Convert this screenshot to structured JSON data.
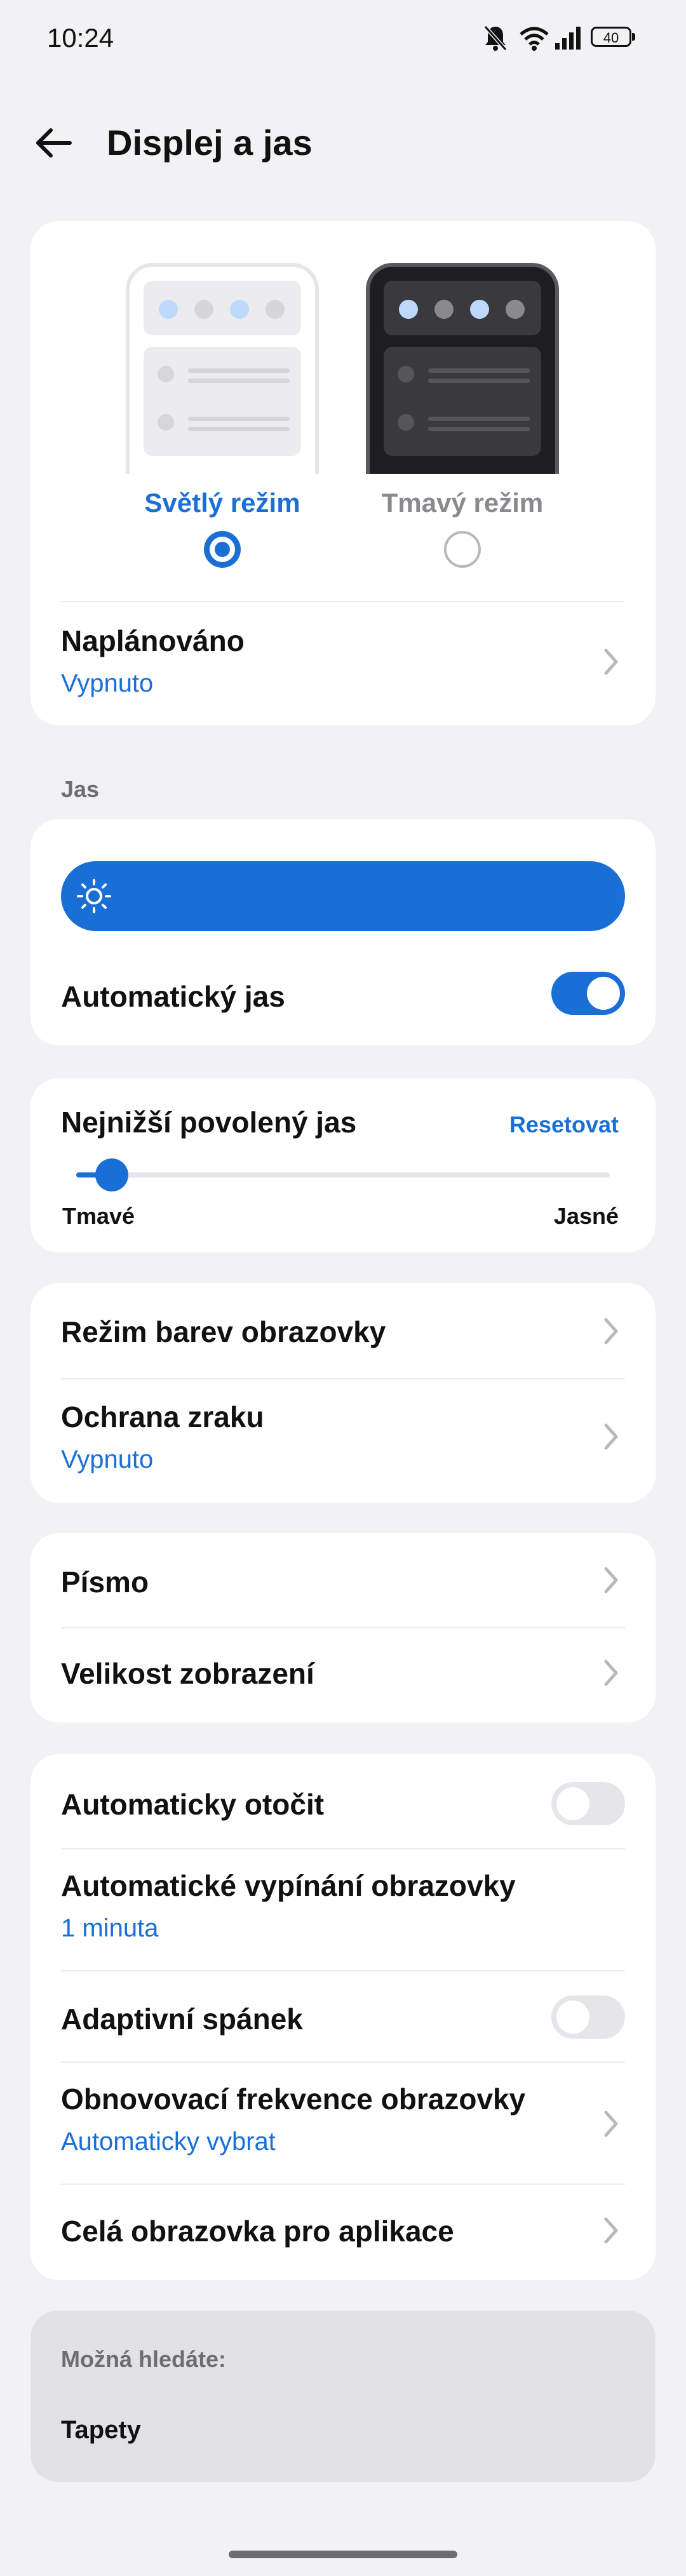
{
  "status_bar": {
    "time": "10:24",
    "battery": "40"
  },
  "header": {
    "title": "Displej a jas"
  },
  "theme": {
    "light_label": "Světlý režim",
    "dark_label": "Tmavý režim",
    "selected": "light",
    "scheduled_title": "Naplánováno",
    "scheduled_value": "Vypnuto"
  },
  "brightness": {
    "section_label": "Jas",
    "auto_label": "Automatický jas",
    "auto_enabled": true
  },
  "min_brightness": {
    "title": "Nejnižší povolený jas",
    "reset_label": "Resetovat",
    "min_label": "Tmavé",
    "max_label": "Jasné",
    "level": 0.04
  },
  "color_card": {
    "color_mode_title": "Režim barev obrazovky",
    "eye_protection_title": "Ochrana zraku",
    "eye_protection_value": "Vypnuto"
  },
  "font_card": {
    "font_title": "Písmo",
    "display_size_title": "Velikost zobrazení"
  },
  "screen_card": {
    "auto_rotate_title": "Automaticky otočit",
    "auto_rotate_enabled": false,
    "screen_timeout_title": "Automatické vypínání obrazovky",
    "screen_timeout_value": "1 minuta",
    "adaptive_sleep_title": "Adaptivní spánek",
    "adaptive_sleep_enabled": false,
    "refresh_rate_title": "Obnovovací frekvence obrazovky",
    "refresh_rate_value": "Automaticky vybrat",
    "fullscreen_apps_title": "Celá obrazovka pro aplikace"
  },
  "suggestions": {
    "header": "Možná hledáte:",
    "items": [
      "Tapety"
    ]
  },
  "colors": {
    "accent": "#1a6fd6",
    "background": "#f2f2f4",
    "card": "#ffffff"
  }
}
